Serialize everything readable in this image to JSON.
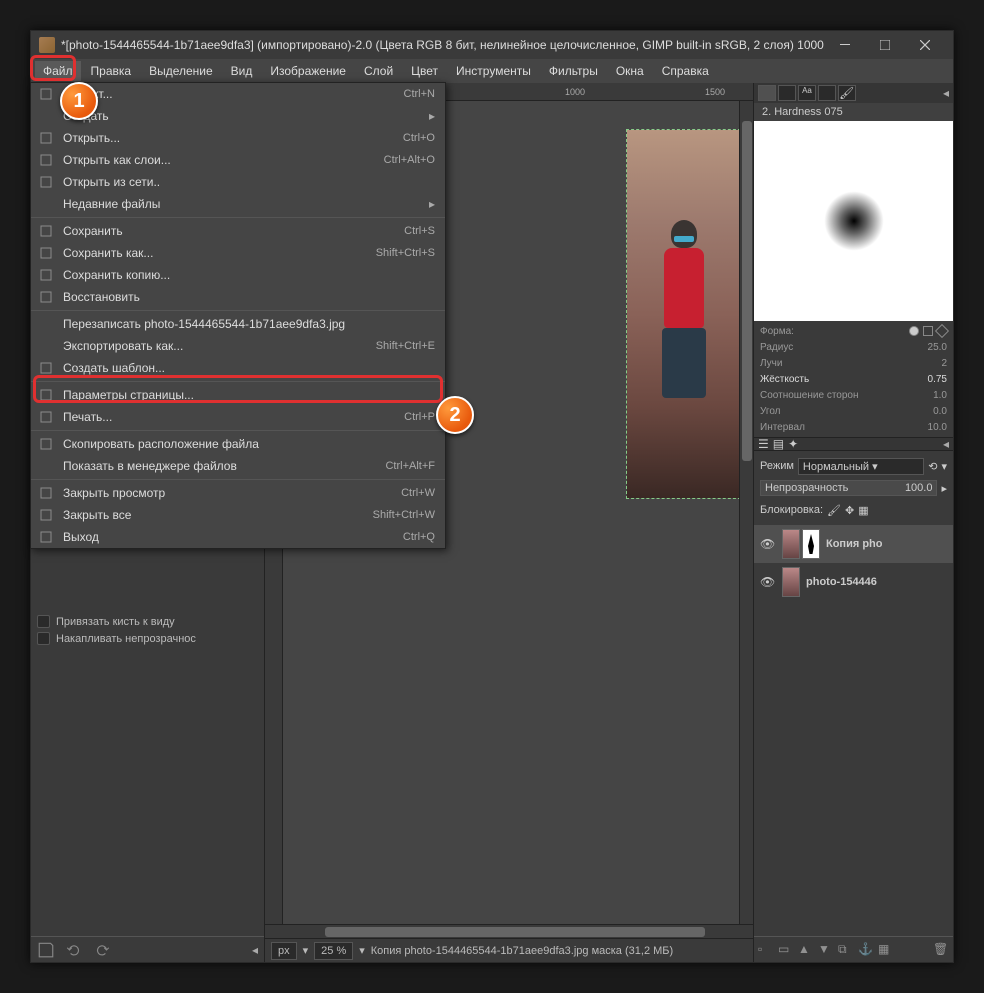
{
  "window": {
    "title": "*[photo-1544465544-1b71aee9dfa3] (импортировано)-2.0 (Цвета RGB 8 бит, нелинейное целочисленное, GIMP built-in sRGB, 2 слоя) 1000..."
  },
  "menubar": [
    "Файл",
    "Правка",
    "Выделение",
    "Вид",
    "Изображение",
    "Слой",
    "Цвет",
    "Инструменты",
    "Фильтры",
    "Окна",
    "Справка"
  ],
  "file_menu": [
    {
      "label": "...роект...",
      "shortcut": "Ctrl+N",
      "icon": "doc"
    },
    {
      "label": "Создать",
      "arrow": true
    },
    {
      "label": "Открыть...",
      "shortcut": "Ctrl+O",
      "icon": "folder"
    },
    {
      "label": "Открыть как слои...",
      "shortcut": "Ctrl+Alt+O",
      "icon": "layers"
    },
    {
      "label": "Открыть из сети..",
      "icon": "globe"
    },
    {
      "label": "Недавние файлы",
      "arrow": true
    },
    {
      "sep": true
    },
    {
      "label": "Сохранить",
      "shortcut": "Ctrl+S",
      "icon": "save"
    },
    {
      "label": "Сохранить как...",
      "shortcut": "Shift+Ctrl+S",
      "icon": "saveas"
    },
    {
      "label": "Сохранить копию...",
      "icon": "copy"
    },
    {
      "label": "Восстановить",
      "icon": "revert"
    },
    {
      "sep": true
    },
    {
      "label": "Перезаписать photo-1544465544-1b71aee9dfa3.jpg"
    },
    {
      "label": "Экспортировать как...",
      "shortcut": "Shift+Ctrl+E",
      "highlight": true
    },
    {
      "label": "Создать шаблон...",
      "icon": "template"
    },
    {
      "sep": true
    },
    {
      "label": "Параметры страницы...",
      "icon": "page"
    },
    {
      "label": "Печать...",
      "shortcut": "Ctrl+P",
      "icon": "print"
    },
    {
      "sep": true
    },
    {
      "label": "Скопировать расположение файла",
      "icon": "copy"
    },
    {
      "label": "Показать в менеджере файлов",
      "shortcut": "Ctrl+Alt+F"
    },
    {
      "sep": true
    },
    {
      "label": "Закрыть просмотр",
      "shortcut": "Ctrl+W",
      "icon": "close"
    },
    {
      "label": "Закрыть все",
      "shortcut": "Shift+Ctrl+W",
      "icon": "close"
    },
    {
      "label": "Выход",
      "shortcut": "Ctrl+Q",
      "icon": "exit"
    }
  ],
  "left_options": [
    "Привязать кисть к виду",
    "Накапливать непрозрачнос"
  ],
  "ruler": {
    "t1": "1000",
    "t2": "1500"
  },
  "status": {
    "unit": "px",
    "zoom": "25 %",
    "info": "Копия photo-1544465544-1b71aee9dfa3.jpg маска (31,2 МБ)"
  },
  "brushes": {
    "title": "2. Hardness 075",
    "rows": [
      {
        "l": "Форма:",
        "shapes": true
      },
      {
        "l": "Радиус",
        "v": "25.0"
      },
      {
        "l": "Лучи",
        "v": "2"
      },
      {
        "l": "Жёсткость",
        "v": "0.75",
        "active": true
      },
      {
        "l": "Соотношение сторон",
        "v": "1.0"
      },
      {
        "l": "Угол",
        "v": "0.0"
      },
      {
        "l": "Интервал",
        "v": "10.0"
      }
    ]
  },
  "layers": {
    "mode_label": "Режим",
    "mode_value": "Нормальный",
    "opacity_label": "Непрозрачность",
    "opacity_value": "100.0",
    "lock_label": "Блокировка:",
    "items": [
      {
        "name": "Копия pho"
      },
      {
        "name": "photo-154446"
      }
    ]
  },
  "badges": {
    "one": "1",
    "two": "2"
  }
}
